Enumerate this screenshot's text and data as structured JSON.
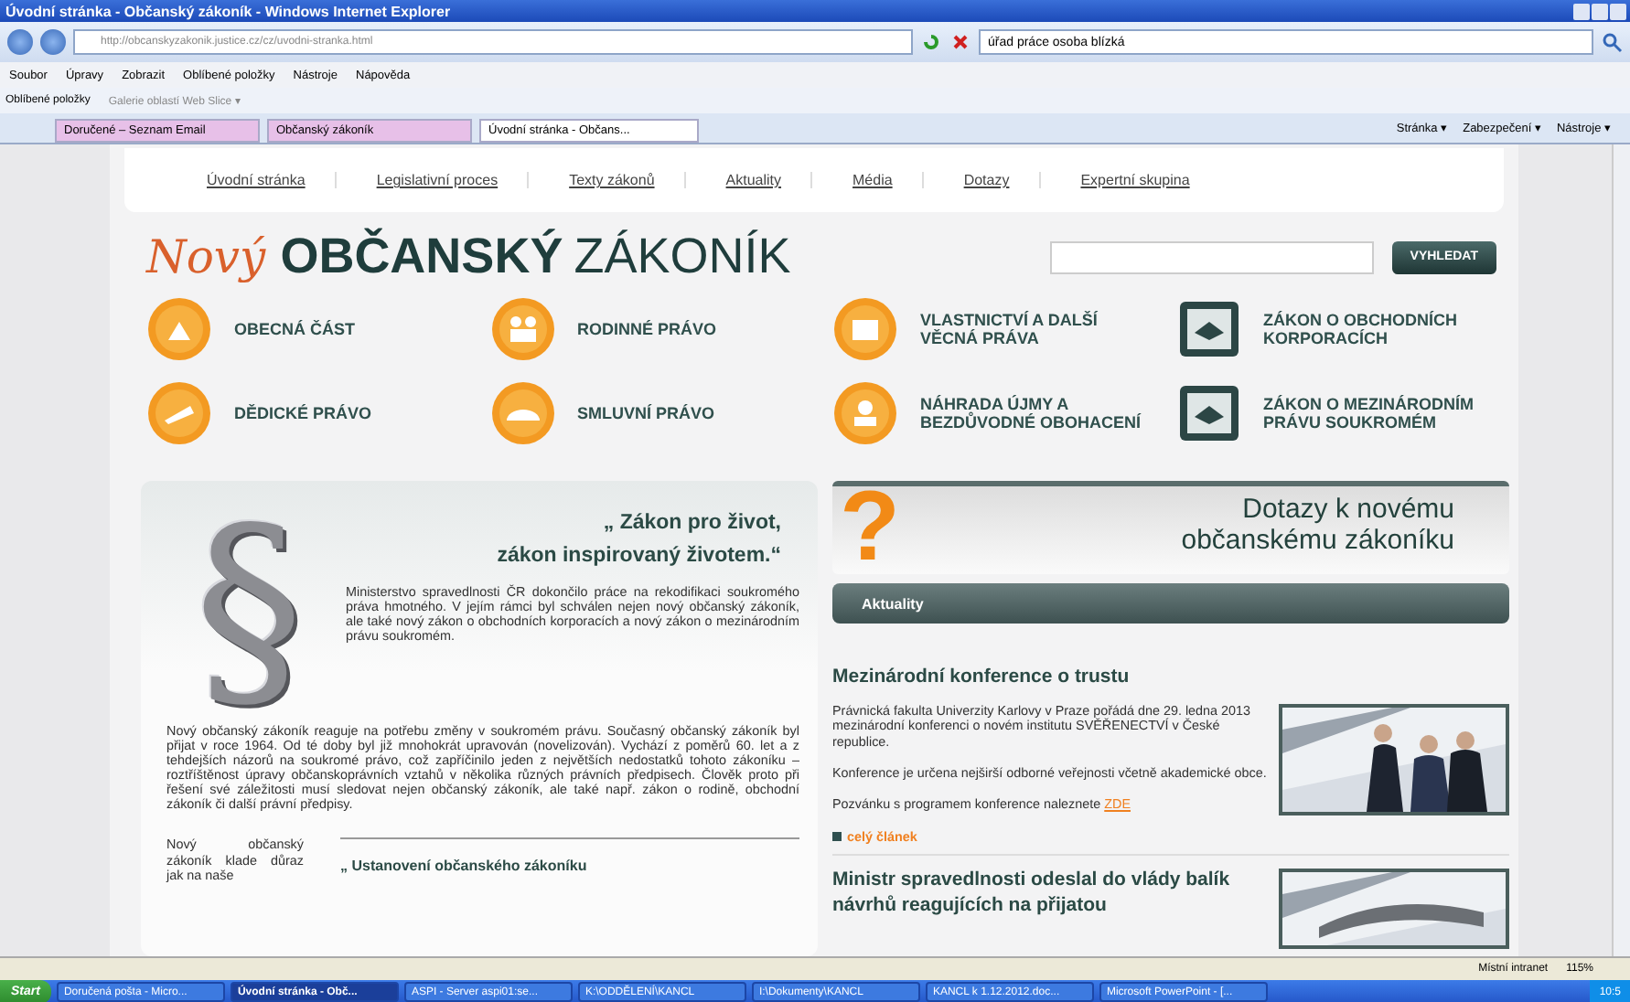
{
  "window": {
    "title": "Úvodní stránka - Občanský zákoník - Windows Internet Explorer"
  },
  "address_bar": {
    "url": "http://obcanskyzakonik.justice.cz/cz/uvodni-stranka.html",
    "search": "úřad práce osoba blízká"
  },
  "menu": [
    "Soubor",
    "Úpravy",
    "Zobrazit",
    "Oblíbené položky",
    "Nástroje",
    "Nápověda"
  ],
  "favorites_bar": {
    "label": "Oblíbené položky",
    "items": [
      "Galerie oblastí Web Slice ▾"
    ]
  },
  "tabs": [
    {
      "label": "Doručené – Seznam Email",
      "selected": false
    },
    {
      "label": "Občanský zákoník",
      "selected": false
    },
    {
      "label": "Úvodní stránka - Občans...",
      "selected": true
    }
  ],
  "command_bar": [
    "Stránka ▾",
    "Zabezpečení ▾",
    "Nástroje ▾"
  ],
  "page": {
    "nav": [
      "Úvodní stránka",
      "Legislativní proces",
      "Texty zákonů",
      "Aktuality",
      "Média",
      "Dotazy",
      "Expertní skupina"
    ],
    "logo": {
      "script": "Nový",
      "bold": "OBČANSKÝ",
      "light": "ZÁKONÍK"
    },
    "search_button": "VYHLEDAT",
    "categories": [
      {
        "label": "OBECNÁ ČÁST",
        "kind": "round"
      },
      {
        "label": "RODINNÉ PRÁVO",
        "kind": "round"
      },
      {
        "label": "VLASTNICTVÍ A DALŠÍ VĚCNÁ PRÁVA",
        "kind": "round"
      },
      {
        "label": "ZÁKON O OBCHODNÍCH KORPORACÍCH",
        "kind": "square"
      },
      {
        "label": "DĚDICKÉ PRÁVO",
        "kind": "round"
      },
      {
        "label": "SMLUVNÍ PRÁVO",
        "kind": "round"
      },
      {
        "label": "NÁHRADA ÚJMY A BEZDŮVODNÉ OBOHACENÍ",
        "kind": "round"
      },
      {
        "label": "ZÁKON O MEZINÁRODNÍM PRÁVU SOUKROMÉM",
        "kind": "square"
      }
    ],
    "intro": {
      "emblem": "§",
      "quote": [
        "„ Zákon pro život,",
        "zákon inspirovaný životem.“"
      ],
      "paragraphs": [
        "Ministerstvo spravedlnosti ČR dokončilo práce na rekodifikaci soukromého práva hmotného. V jejím rámci byl schválen nejen nový občanský zákoník, ale také nový zákon o obchodních korporacích a nový zákon o mezinárodním právu soukromém.",
        "Nový občanský zákoník reaguje na potřebu změny v soukromém právu. Současný občanský zákoník byl přijat v roce 1964. Od té doby byl již mnohokrát upravován (novelizován). Vychází z poměrů 60. let a z tehdejších názorů na soukromé právo, což zapříčinilo jeden z největších nedostatků tohoto zákoníku – roztříštěnost úpravy občanskoprávních vztahů v několika různých právních předpisech. Člověk proto při řešení své záležitosti musí sledovat nejen občanský zákoník, ale také např. zákon o rodině, obchodní zákoník či další právní předpisy."
      ],
      "bottom_text": "Nový občanský zákoník klade důraz jak na naše",
      "subheading": "„ Ustanovení občanského zákoníku"
    },
    "questions_banner": {
      "mark": "?",
      "title": "Dotazy k novému občanskému zákoníku"
    },
    "news": {
      "heading": "Aktuality",
      "articles": [
        {
          "title": "Mezinárodní konference o trustu",
          "paragraphs": [
            "Právnická fakulta Univerzity Karlovy v Praze pořádá dne 29. ledna 2013 mezinárodní konferenci o novém institutu SVĚŘENECTVÍ v České republice.",
            "Konference je určena nejširší odborné veřejnosti včetně akademické obce."
          ],
          "invite": "Pozvánku s programem konference naleznete",
          "link": "ZDE",
          "more": "celý článek"
        },
        {
          "title": "Ministr spravedlnosti odeslal do vlády balík návrhů reagujících na přijatou"
        }
      ]
    }
  },
  "status_bar": {
    "zone": "Místní intranet",
    "zoom": "115%"
  },
  "taskbar": {
    "start": "Start",
    "items": [
      {
        "label": "Doručená pošta - Micro...",
        "selected": false
      },
      {
        "label": "Úvodní stránka - Obč...",
        "selected": true
      },
      {
        "label": "ASPI - Server aspi01:se...",
        "selected": false
      },
      {
        "label": "K:\\ODDĚLENÍ\\KANCL",
        "selected": false
      },
      {
        "label": "I:\\Dokumenty\\KANCL",
        "selected": false
      },
      {
        "label": "KANCL k 1.12.2012.doc...",
        "selected": false
      },
      {
        "label": "Microsoft PowerPoint - [...",
        "selected": false
      }
    ],
    "clock": "10:5"
  }
}
